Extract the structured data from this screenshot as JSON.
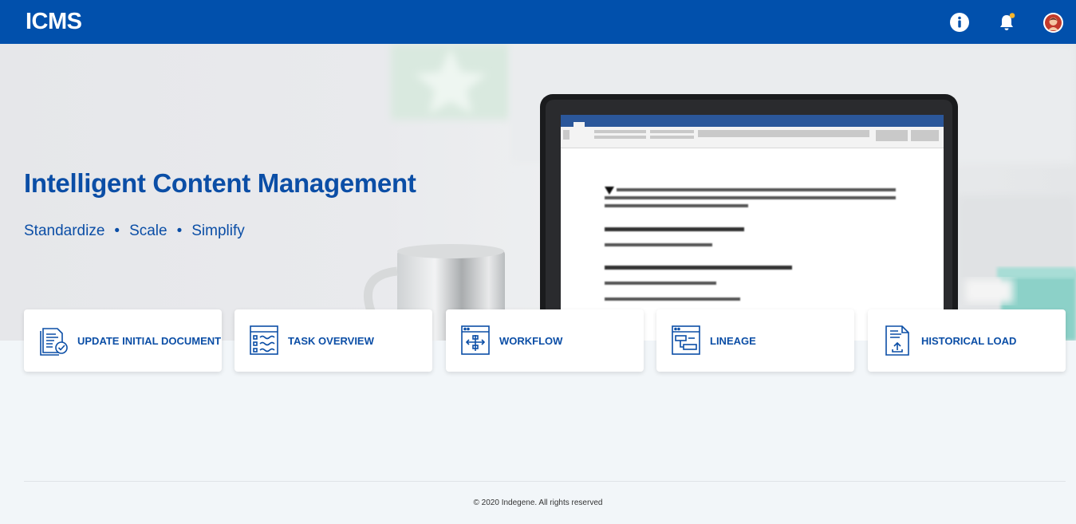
{
  "header": {
    "logo": "ICMS",
    "icons": [
      "info-icon",
      "bell-icon",
      "avatar"
    ],
    "accent": "#0150ac",
    "notification_dot": "#f7b52c"
  },
  "hero": {
    "title": "Intelligent Content Management",
    "subtitle": {
      "item1": "Standardize",
      "item2": "Scale",
      "item3": "Simplify",
      "separator": "•"
    },
    "image": "laptop-document-illustration"
  },
  "cards": [
    {
      "label": "UPDATE INITIAL DOCUMENT",
      "icon": "document-check-icon"
    },
    {
      "label": "TASK OVERVIEW",
      "icon": "task-list-icon"
    },
    {
      "label": "WORKFLOW",
      "icon": "workflow-icon"
    },
    {
      "label": "LINEAGE",
      "icon": "lineage-icon"
    },
    {
      "label": "HISTORICAL LOAD",
      "icon": "upload-document-icon"
    }
  ],
  "footer": {
    "copyright": "© 2020 Indegene. All rights reserved"
  },
  "colors": {
    "brand_blue": "#0b4ea6",
    "background": "#f2f6f9"
  }
}
